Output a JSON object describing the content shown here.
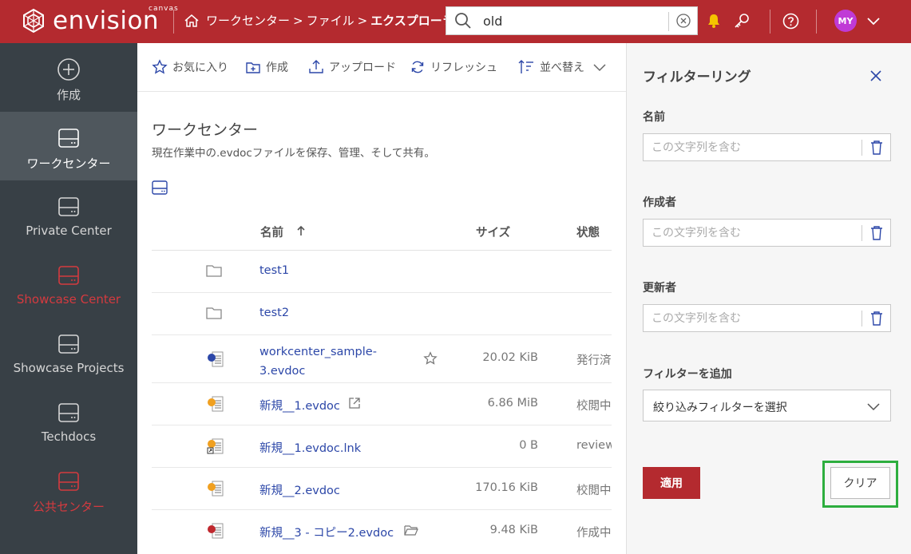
{
  "app": {
    "logo_text": "envision",
    "logo_sub": "canvas"
  },
  "breadcrumb": {
    "items": [
      "ワークセンター",
      "ファイル"
    ],
    "current": "エクスプローラー",
    "sep": ">"
  },
  "search": {
    "value": "old"
  },
  "user": {
    "initials": "MY"
  },
  "sidebar": {
    "items": [
      {
        "label": "作成"
      },
      {
        "label": "ワークセンター"
      },
      {
        "label": "Private Center"
      },
      {
        "label": "Showcase Center"
      },
      {
        "label": "Showcase Projects"
      },
      {
        "label": "Techdocs"
      },
      {
        "label": "公共センター"
      }
    ]
  },
  "toolbar": {
    "favorite": "お気に入り",
    "create": "作成",
    "upload": "アップロード",
    "refresh": "リフレッシュ",
    "sort": "並べ替え"
  },
  "page": {
    "title": "ワークセンター",
    "description": "現在作業中の.evdocファイルを保存、管理、そして共有。"
  },
  "table": {
    "headers": {
      "name": "名前",
      "size": "サイズ",
      "status": "状態"
    },
    "rows": [
      {
        "name": "test1",
        "size": "",
        "status": "",
        "type": "folder"
      },
      {
        "name": "test2",
        "size": "",
        "status": "",
        "type": "folder"
      },
      {
        "name": "workcenter_sample-",
        "name2": "3.evdoc",
        "size": "20.02 KiB",
        "status": "発行済み",
        "type": "doc-blue"
      },
      {
        "name": "新規__1.evdoc",
        "size": "6.86 MiB",
        "status": "校閲中",
        "type": "doc-orange"
      },
      {
        "name": "新規__1.evdoc.lnk",
        "size": "0 B",
        "status": "review",
        "type": "doc-link"
      },
      {
        "name": "新規__2.evdoc",
        "size": "170.16 KiB",
        "status": "校閲中",
        "type": "doc-orange"
      },
      {
        "name": "新規__3 - コピー2.evdoc",
        "size": "9.48 KiB",
        "status": "作成中",
        "type": "doc-red"
      }
    ]
  },
  "filter": {
    "title": "フィルターリング",
    "name_label": "名前",
    "author_label": "作成者",
    "updater_label": "更新者",
    "placeholder": "この文字列を含む",
    "add_label": "フィルターを追加",
    "select_value": "絞り込みフィルターを選択",
    "apply": "適用",
    "clear": "クリア"
  },
  "colors": {
    "brand": "#b42a2f",
    "sidebar": "#384046",
    "link": "#2c47a8",
    "highlight": "#2dae3e"
  }
}
